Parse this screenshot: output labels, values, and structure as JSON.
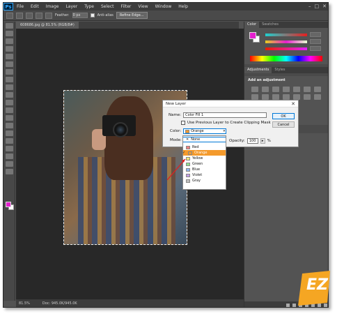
{
  "app": {
    "logo": "Ps"
  },
  "menu": [
    "File",
    "Edit",
    "Image",
    "Layer",
    "Type",
    "Select",
    "Filter",
    "View",
    "Window",
    "Help"
  ],
  "window_controls": {
    "minimize": "–",
    "maximize": "□",
    "close": "✕"
  },
  "options_bar": {
    "feather_label": "Feather:",
    "feather_value": "0 px",
    "antialias_label": "Anti-alias",
    "refine_edge_label": "Refine Edge..."
  },
  "document": {
    "tab_title": "608686.jpg @ 81.5% (RGB/8#)"
  },
  "status": {
    "zoom": "81.5%",
    "doc_size": "Doc: 945.0K/945.0K"
  },
  "colors": {
    "foreground": "#e51fcf",
    "background": "#ffffff"
  },
  "panels": {
    "color_tabs": [
      "Color",
      "Swatches"
    ],
    "adjustments_tabs": [
      "Adjustments",
      "Styles"
    ],
    "adjustments_title": "Add an adjustment"
  },
  "dialog": {
    "title": "New Layer",
    "close": "✕",
    "name_label": "Name:",
    "name_value": "Color Fill 1",
    "clipping_label": "Use Previous Layer to Create Clipping Mask",
    "color_label": "Color:",
    "color_value": "Orange",
    "mode_label": "Mode:",
    "opacity_label": "Opacity:",
    "opacity_value": "100",
    "opacity_unit": "%",
    "ok_label": "OK",
    "cancel_label": "Cancel",
    "dropdown_arrow": "▾",
    "opacity_arrow": "▸"
  },
  "color_options": [
    {
      "label": "None",
      "color": "none",
      "glyph": "✕"
    },
    {
      "label": "Red",
      "color": "#f08080"
    },
    {
      "label": "Orange",
      "color": "#f49a2c"
    },
    {
      "label": "Yellow",
      "color": "#f4e87a"
    },
    {
      "label": "Green",
      "color": "#90e090"
    },
    {
      "label": "Blue",
      "color": "#90b8f0"
    },
    {
      "label": "Violet",
      "color": "#c0a0e8"
    },
    {
      "label": "Gray",
      "color": "#c0c0c0"
    }
  ],
  "selected_color_index": 2,
  "checkmark": "✓",
  "watermark": {
    "text": "EZ",
    "color": "#f5a623"
  }
}
